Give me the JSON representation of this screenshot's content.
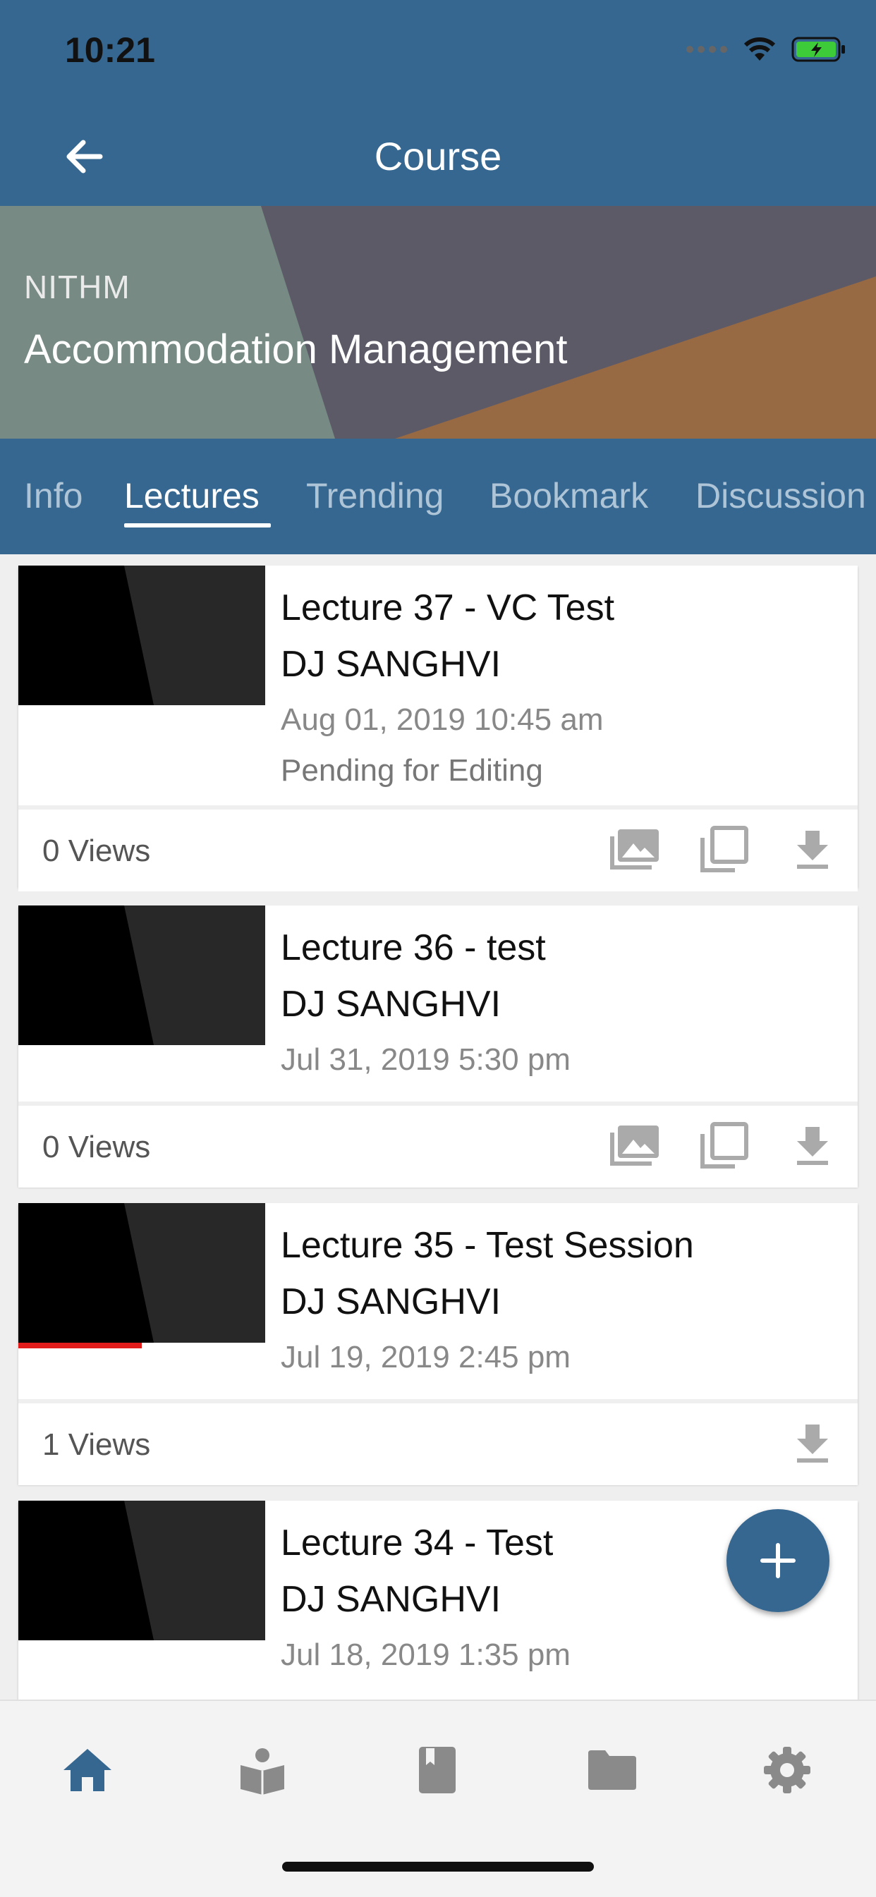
{
  "status": {
    "time": "10:21"
  },
  "header": {
    "title": "Course"
  },
  "banner": {
    "org": "NITHM",
    "course_title": "Accommodation Management"
  },
  "tabs": [
    {
      "label": "Info"
    },
    {
      "label": "Lectures"
    },
    {
      "label": "Trending"
    },
    {
      "label": "Bookmark"
    },
    {
      "label": "Discussion"
    }
  ],
  "active_tab": "Lectures",
  "lectures": [
    {
      "title": "Lecture 37 - VC Test",
      "author": "DJ SANGHVI",
      "date": "Aug 01, 2019 10:45 am",
      "status": "Pending for Editing",
      "views": "0 Views",
      "actions": [
        "gallery-icon",
        "copy-icon",
        "download-icon"
      ]
    },
    {
      "title": "Lecture 36 - test",
      "author": "DJ SANGHVI",
      "date": "Jul 31, 2019 5:30 pm",
      "views": "0 Views",
      "actions": [
        "gallery-icon",
        "copy-icon",
        "download-icon"
      ]
    },
    {
      "title": "Lecture 35 - Test Session",
      "author": "DJ SANGHVI",
      "date": "Jul 19, 2019 2:45 pm",
      "views": "1 Views",
      "watch_progress": 0.5,
      "actions": [
        "download-icon"
      ]
    },
    {
      "title": "Lecture 34 - Test",
      "author": "DJ SANGHVI",
      "date": "Jul 18, 2019 1:35 pm"
    }
  ],
  "bottom_nav": [
    "home-icon",
    "reader-icon",
    "book-icon",
    "folder-icon",
    "settings-icon"
  ],
  "colors": {
    "primary": "#366790",
    "accent_progress": "#e21b1b"
  }
}
